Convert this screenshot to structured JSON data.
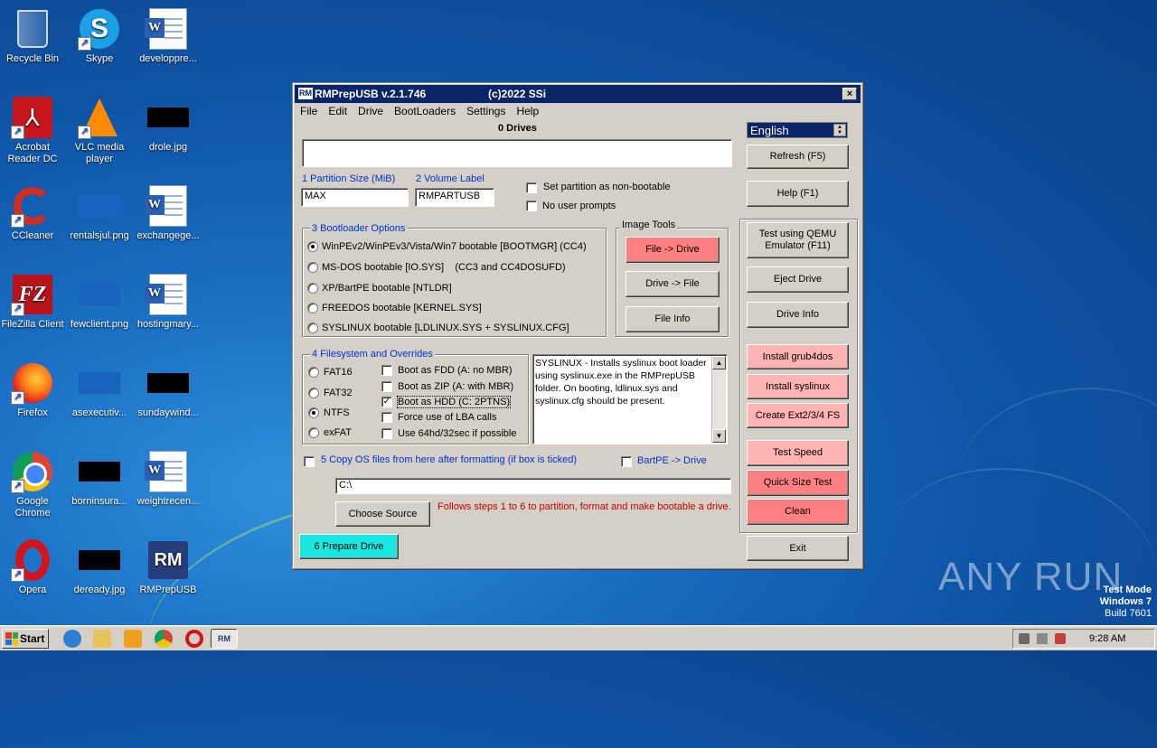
{
  "desktop": {
    "icons": [
      {
        "label": "Recycle Bin"
      },
      {
        "label": "Skype"
      },
      {
        "label": "developpre..."
      },
      {
        "label": "Acrobat Reader DC"
      },
      {
        "label": "VLC media player"
      },
      {
        "label": "drole.jpg"
      },
      {
        "label": "CCleaner"
      },
      {
        "label": "rentalsjul.png"
      },
      {
        "label": "exchangege..."
      },
      {
        "label": "FileZilla Client"
      },
      {
        "label": "fewclient.png"
      },
      {
        "label": "hostingmary..."
      },
      {
        "label": "Firefox"
      },
      {
        "label": "asexecutiv..."
      },
      {
        "label": "sundaywind..."
      },
      {
        "label": "Google Chrome"
      },
      {
        "label": "borninsura..."
      },
      {
        "label": "weightrecen..."
      },
      {
        "label": "Opera"
      },
      {
        "label": "deready.jpg"
      },
      {
        "label": "RMPrepUSB"
      }
    ],
    "watermark": "ANY RUN",
    "testmode": {
      "line1": "Test Mode",
      "line2": "Windows 7",
      "line3": "Build 7601"
    }
  },
  "window": {
    "title": "RMPrepUSB v.2.1.746",
    "copyright": "(c)2022 SSi",
    "title_icon": "RM",
    "close": "×",
    "menu": [
      "File",
      "Edit",
      "Drive",
      "BootLoaders",
      "Settings",
      "Help"
    ],
    "drives_header": "0 Drives",
    "language": "English",
    "partition_size_label": "1 Partition Size (MiB)",
    "partition_size_value": "MAX",
    "volume_label_label": "2 Volume Label",
    "volume_label_value": "RMPARTUSB",
    "opt_nonbootable": "Set partition as non-bootable",
    "opt_noprompts": "No user prompts",
    "bootloader_group": "3 Bootloader Options",
    "bootloaders": [
      "WinPEv2/WinPEv3/Vista/Win7 bootable [BOOTMGR] (CC4)",
      "MS-DOS bootable [IO.SYS]    (CC3 and CC4DOSUFD)",
      "XP/BartPE bootable [NTLDR]",
      "FREEDOS bootable [KERNEL.SYS]",
      "SYSLINUX bootable [LDLINUX.SYS + SYSLINUX.CFG]"
    ],
    "image_tools_group": "Image Tools",
    "image_tools": [
      "File -> Drive",
      "Drive -> File",
      "File Info"
    ],
    "fs_group": "4 Filesystem and Overrides",
    "filesystems": [
      "FAT16",
      "FAT32",
      "NTFS",
      "exFAT"
    ],
    "overrides": [
      "Boot as FDD (A: no MBR)",
      "Boot as ZIP (A: with MBR)",
      "Boot as HDD (C: 2PTNS)",
      "Force use of LBA calls",
      "Use 64hd/32sec if possible"
    ],
    "info_text": "SYSLINUX - Installs syslinux boot loader using syslinux.exe in the RMPrepUSB folder. On booting, ldlinux.sys and syslinux.cfg should be present.",
    "copy_files_label": "5 Copy OS files from here after formatting (if box is ticked)",
    "bartpe_label": "BartPE -> Drive",
    "source_path": "C:\\",
    "choose_source": "Choose Source",
    "steps_note": "Follows steps 1 to 6 to partition, format and make bootable a drive.",
    "prepare_drive": "6 Prepare Drive",
    "right_buttons": {
      "refresh": "Refresh (F5)",
      "help": "Help (F1)",
      "qemu": "Test using QEMU Emulator (F11)",
      "eject": "Eject Drive",
      "drive_info": "Drive Info",
      "grub4dos": "Install grub4dos",
      "syslinux": "Install syslinux",
      "ext": "Create Ext2/3/4 FS",
      "test_speed": "Test Speed",
      "quick_size": "Quick Size Test",
      "clean": "Clean",
      "exit": "Exit"
    }
  },
  "taskbar": {
    "start": "Start",
    "clock": "9:28 AM"
  }
}
